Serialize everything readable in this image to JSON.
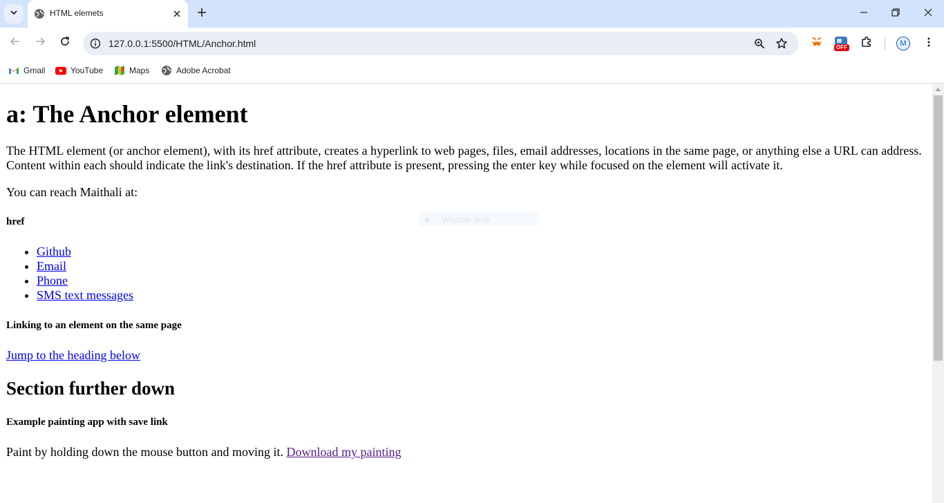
{
  "browser": {
    "tab": {
      "title": "HTML elemets"
    },
    "address_bar": {
      "url": "127.0.0.1:5500/HTML/Anchor.html"
    },
    "extensions": {
      "badge_text": "OFF"
    },
    "profile": {
      "initial": "M"
    },
    "bookmarks": [
      {
        "label": "Gmail",
        "icon": "gmail-icon"
      },
      {
        "label": "YouTube",
        "icon": "youtube-icon"
      },
      {
        "label": "Maps",
        "icon": "maps-icon"
      },
      {
        "label": "Adobe Acrobat",
        "icon": "globe-icon"
      }
    ]
  },
  "page": {
    "title": "a: The Anchor element",
    "intro": "The HTML element (or anchor element), with its href attribute, creates a hyperlink to web pages, files, email addresses, locations in the same page, or anything else a URL can address. Content within each should indicate the link's destination. If the href attribute is present, pressing the enter key while focused on the element will activate it.",
    "reach": "You can reach Maithali at:",
    "href_heading": "href",
    "links": [
      "Github",
      "Email",
      "Phone",
      "SMS text messages"
    ],
    "same_page_heading": "Linking to an element on the same page",
    "jump_link": "Jump to the heading below",
    "section_heading": "Section further down",
    "painting_heading": "Example painting app with save link",
    "paint_text": "Paint by holding down the mouse button and moving it.",
    "download_link": "Download my painting"
  },
  "overlay": {
    "snip_label": "Window Snip"
  },
  "colors": {
    "tab_strip": "#d3e3fd",
    "omnibox": "#e9eef6",
    "link": "#0000ee",
    "visited_link": "#551a8b"
  }
}
